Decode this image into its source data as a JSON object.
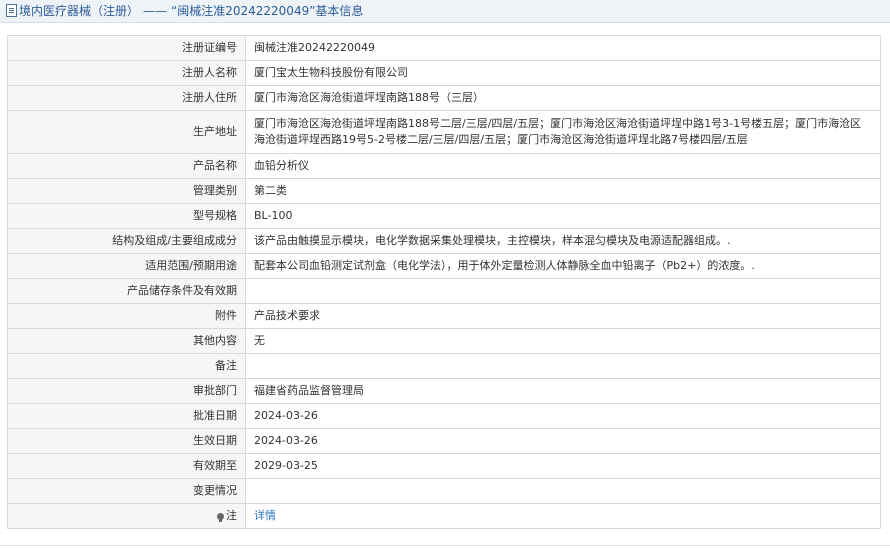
{
  "header": {
    "category": "境内医疗器械（注册）",
    "separator": "——",
    "title": "“闽械注准20242220049”基本信息"
  },
  "rows": [
    {
      "label": "注册证编号",
      "value": "闽械注准20242220049"
    },
    {
      "label": "注册人名称",
      "value": "厦门宝太生物科技股份有限公司"
    },
    {
      "label": "注册人住所",
      "value": "厦门市海沧区海沧街道坪埕南路188号（三层）"
    },
    {
      "label": "生产地址",
      "value": "厦门市海沧区海沧街道坪埕南路188号二层/三层/四层/五层；厦门市海沧区海沧街道坪埕中路1号3-1号楼五层；厦门市海沧区海沧街道坪埕西路19号5-2号楼二层/三层/四层/五层；厦门市海沧区海沧街道坪埕北路7号楼四层/五层"
    },
    {
      "label": "产品名称",
      "value": "血铅分析仪"
    },
    {
      "label": "管理类别",
      "value": "第二类"
    },
    {
      "label": "型号规格",
      "value": "BL-100"
    },
    {
      "label": "结构及组成/主要组成成分",
      "value": "该产品由触摸显示模块，电化学数据采集处理模块，主控模块，样本混匀模块及电源适配器组成。."
    },
    {
      "label": "适用范围/预期用途",
      "value": "配套本公司血铅测定试剂盒（电化学法），用于体外定量检测人体静脉全血中铅离子（Pb2+）的浓度。."
    },
    {
      "label": "产品储存条件及有效期",
      "value": ""
    },
    {
      "label": "附件",
      "value": "产品技术要求"
    },
    {
      "label": "其他内容",
      "value": "无"
    },
    {
      "label": "备注",
      "value": ""
    },
    {
      "label": "审批部门",
      "value": "福建省药品监督管理局"
    },
    {
      "label": "批准日期",
      "value": "2024-03-26"
    },
    {
      "label": "生效日期",
      "value": "2024-03-26"
    },
    {
      "label": "有效期至",
      "value": "2029-03-25"
    },
    {
      "label": "变更情况",
      "value": ""
    }
  ],
  "note": {
    "label": "注",
    "link": "详情",
    "icon": "lightbulb-icon"
  }
}
